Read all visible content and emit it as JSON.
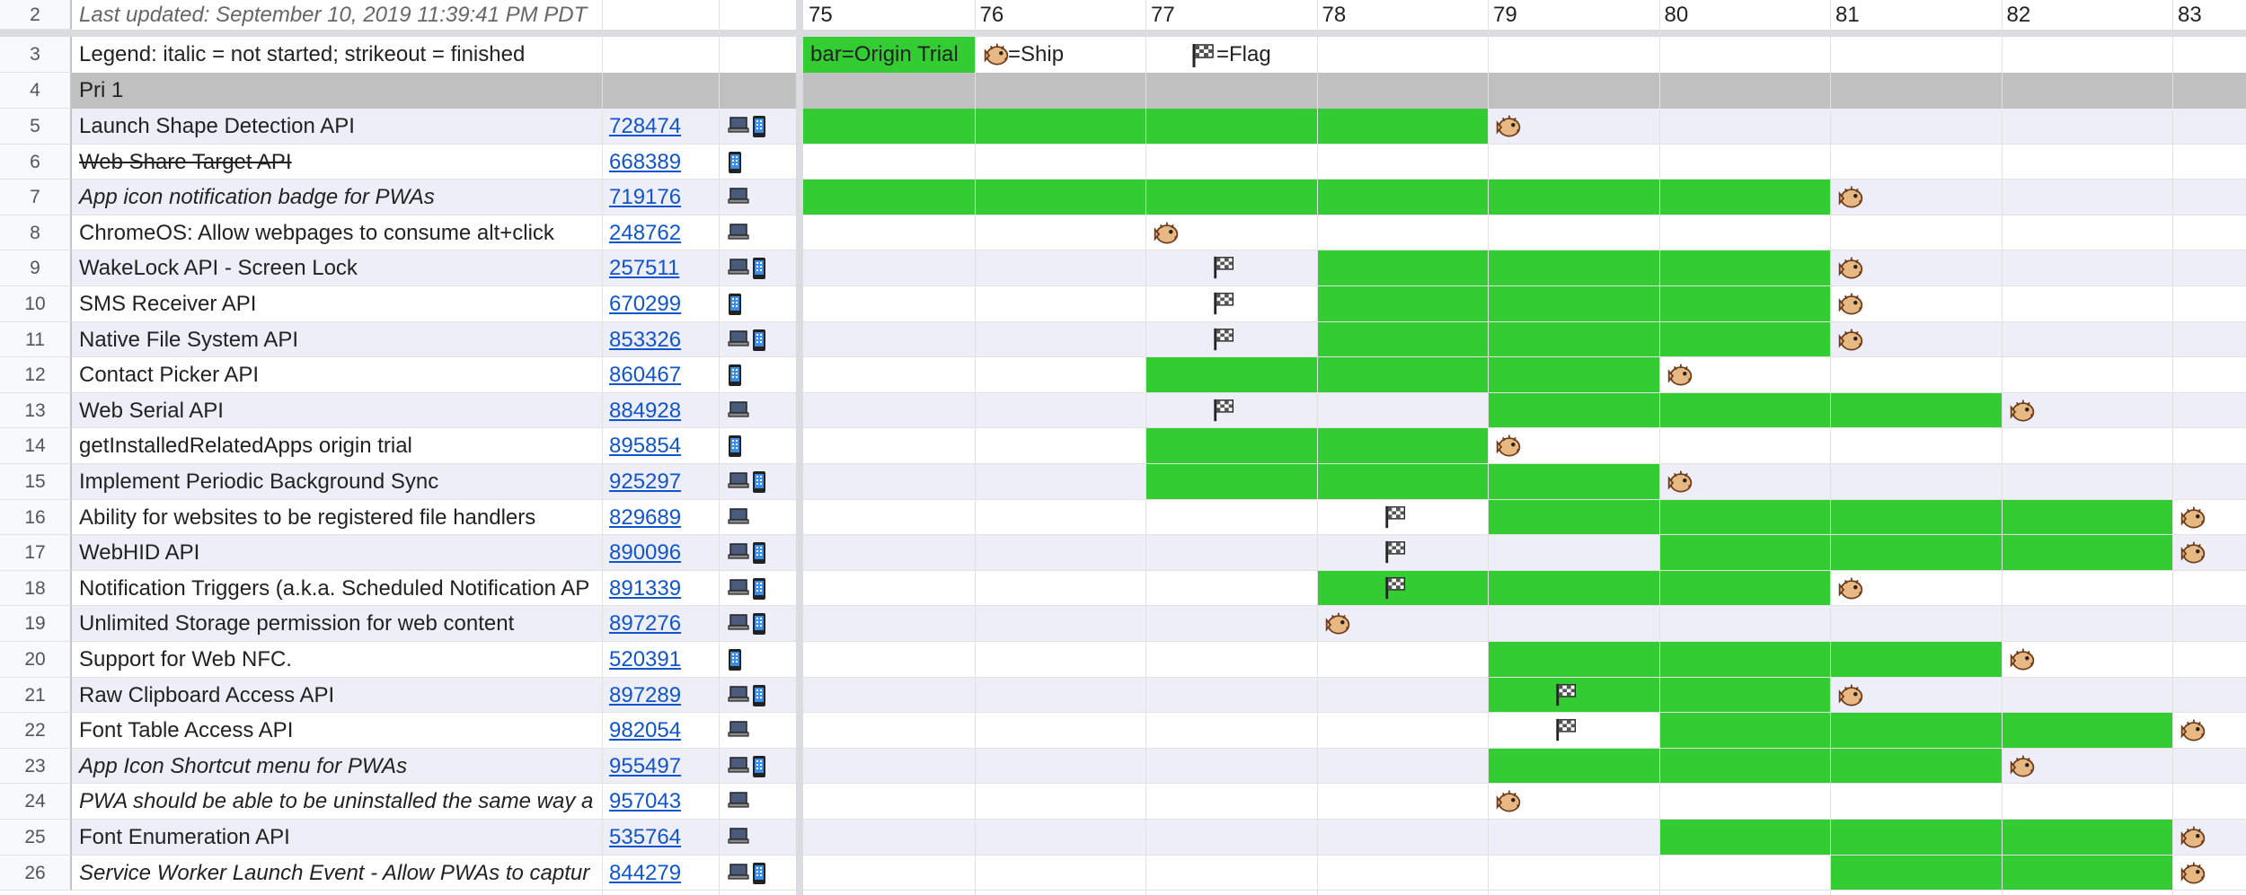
{
  "header": {
    "rownum": "2",
    "updated": "Last updated: September 10, 2019 11:39:41 PM PDT",
    "versions": [
      "75",
      "76",
      "77",
      "78",
      "79",
      "80",
      "81",
      "82",
      "83"
    ]
  },
  "legend": {
    "rownum": "3",
    "text": "Legend: italic = not started; strikeout = finished",
    "bar_label": "bar=Origin Trial",
    "ship_label": "=Ship",
    "flag_label": "=Flag"
  },
  "section": {
    "rownum": "4",
    "title": "Pri 1"
  },
  "colors": {
    "bar": "#33cc33",
    "section_bg": "#c0c0c0",
    "band_odd": "#eeeef8",
    "link": "#1155cc"
  },
  "icons": {
    "ship": "pufferfish-icon",
    "flag": "checkered-flag-icon",
    "laptop": "laptop-icon",
    "phone": "phone-icon"
  },
  "rows": [
    {
      "n": "5",
      "name": "Launch Shape Detection API",
      "bug": "728474",
      "style": "",
      "devices": [
        "laptop",
        "phone"
      ],
      "ot": [
        [
          75,
          79
        ]
      ],
      "ship": 79,
      "flag": null
    },
    {
      "n": "6",
      "name": "Web Share Target API",
      "bug": "668389",
      "style": "strike",
      "devices": [
        "phone"
      ],
      "ot": [],
      "ship": null,
      "flag": null
    },
    {
      "n": "7",
      "name": "App icon notification badge for PWAs",
      "bug": "719176",
      "style": "ital",
      "devices": [
        "laptop"
      ],
      "ot": [
        [
          75,
          81
        ]
      ],
      "ship": 81,
      "flag": null
    },
    {
      "n": "8",
      "name": "ChromeOS: Allow webpages to consume alt+click",
      "bug": "248762",
      "style": "",
      "devices": [
        "laptop"
      ],
      "ot": [],
      "ship": 77,
      "flag": null
    },
    {
      "n": "9",
      "name": "WakeLock API - Screen Lock",
      "bug": "257511",
      "style": "",
      "devices": [
        "laptop",
        "phone"
      ],
      "ot": [
        [
          78,
          81
        ]
      ],
      "ship": 81,
      "flag": 77.5
    },
    {
      "n": "10",
      "name": "SMS Receiver API",
      "bug": "670299",
      "style": "",
      "devices": [
        "phone"
      ],
      "ot": [
        [
          78,
          81
        ]
      ],
      "ship": 81,
      "flag": 77.5
    },
    {
      "n": "11",
      "name": "Native File System API",
      "bug": "853326",
      "style": "",
      "devices": [
        "laptop",
        "phone"
      ],
      "ot": [
        [
          78,
          81
        ]
      ],
      "ship": 81,
      "flag": 77.5
    },
    {
      "n": "12",
      "name": "Contact Picker API",
      "bug": "860467",
      "style": "",
      "devices": [
        "phone"
      ],
      "ot": [
        [
          77,
          80
        ]
      ],
      "ship": 80,
      "flag": null
    },
    {
      "n": "13",
      "name": "Web Serial API",
      "bug": "884928",
      "style": "",
      "devices": [
        "laptop"
      ],
      "ot": [
        [
          79,
          82
        ]
      ],
      "ship": 82,
      "flag": 77.5
    },
    {
      "n": "14",
      "name": "getInstalledRelatedApps origin trial",
      "bug": "895854",
      "style": "",
      "devices": [
        "phone"
      ],
      "ot": [
        [
          77,
          79
        ]
      ],
      "ship": 79,
      "flag": null
    },
    {
      "n": "15",
      "name": "Implement Periodic Background Sync",
      "bug": "925297",
      "style": "",
      "devices": [
        "laptop",
        "phone"
      ],
      "ot": [
        [
          77,
          80
        ]
      ],
      "ship": 80,
      "flag": null
    },
    {
      "n": "16",
      "name": "Ability for websites to be registered file handlers",
      "bug": "829689",
      "style": "",
      "devices": [
        "laptop"
      ],
      "ot": [
        [
          79,
          83
        ]
      ],
      "ship": 83,
      "flag": 78.5
    },
    {
      "n": "17",
      "name": "WebHID API",
      "bug": "890096",
      "style": "",
      "devices": [
        "laptop",
        "phone"
      ],
      "ot": [
        [
          80,
          83
        ]
      ],
      "ship": 83,
      "flag": 78.5
    },
    {
      "n": "18",
      "name": "Notification Triggers (a.k.a. Scheduled Notification AP",
      "bug": "891339",
      "style": "",
      "devices": [
        "laptop",
        "phone"
      ],
      "ot": [
        [
          78,
          81
        ]
      ],
      "ship": 81,
      "flag": 78.5
    },
    {
      "n": "19",
      "name": "Unlimited Storage permission for web content",
      "bug": "897276",
      "style": "",
      "devices": [
        "laptop",
        "phone"
      ],
      "ot": [],
      "ship": 78,
      "flag": null
    },
    {
      "n": "20",
      "name": "Support for Web NFC.",
      "bug": "520391",
      "style": "",
      "devices": [
        "phone"
      ],
      "ot": [
        [
          79,
          82
        ]
      ],
      "ship": 82,
      "flag": null
    },
    {
      "n": "21",
      "name": "Raw Clipboard Access API",
      "bug": "897289",
      "style": "",
      "devices": [
        "laptop",
        "phone"
      ],
      "ot": [
        [
          79,
          81
        ]
      ],
      "ship": 81,
      "flag": 79.5
    },
    {
      "n": "22",
      "name": "Font Table Access API",
      "bug": "982054",
      "style": "",
      "devices": [
        "laptop"
      ],
      "ot": [
        [
          80,
          83
        ]
      ],
      "ship": 83,
      "flag": 79.5
    },
    {
      "n": "23",
      "name": "App Icon Shortcut menu for PWAs",
      "bug": "955497",
      "style": "ital",
      "devices": [
        "laptop",
        "phone"
      ],
      "ot": [
        [
          79,
          82
        ]
      ],
      "ship": 82,
      "flag": null
    },
    {
      "n": "24",
      "name": "PWA should be able to be uninstalled the same way a",
      "bug": "957043",
      "style": "ital",
      "devices": [
        "laptop"
      ],
      "ot": [],
      "ship": 79,
      "flag": null
    },
    {
      "n": "25",
      "name": "Font Enumeration API",
      "bug": "535764",
      "style": "",
      "devices": [
        "laptop"
      ],
      "ot": [
        [
          80,
          83
        ]
      ],
      "ship": 83,
      "flag": null
    },
    {
      "n": "26",
      "name": "Service Worker Launch Event - Allow PWAs to captur",
      "bug": "844279",
      "style": "ital",
      "devices": [
        "laptop",
        "phone"
      ],
      "ot": [
        [
          81,
          83
        ]
      ],
      "ship": 83,
      "flag": null
    }
  ]
}
